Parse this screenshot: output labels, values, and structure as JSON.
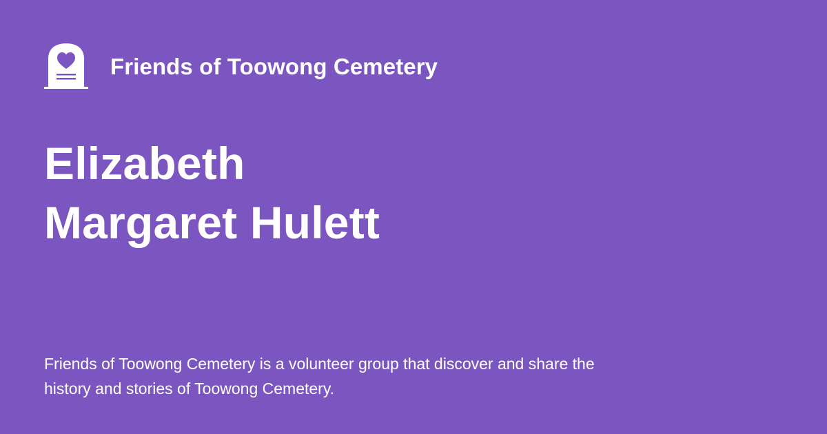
{
  "brand": {
    "name": "Friends of Toowong Cemetery",
    "icon": "headstone-heart-icon"
  },
  "page": {
    "title_line_1": "Elizabeth",
    "title_line_2": "Margaret Hulett",
    "description": "Friends of Toowong Cemetery is a volunteer group that discover and share the history and stories of Toowong Cemetery."
  },
  "colors": {
    "background": "#7b56c1",
    "foreground": "#ffffff"
  }
}
